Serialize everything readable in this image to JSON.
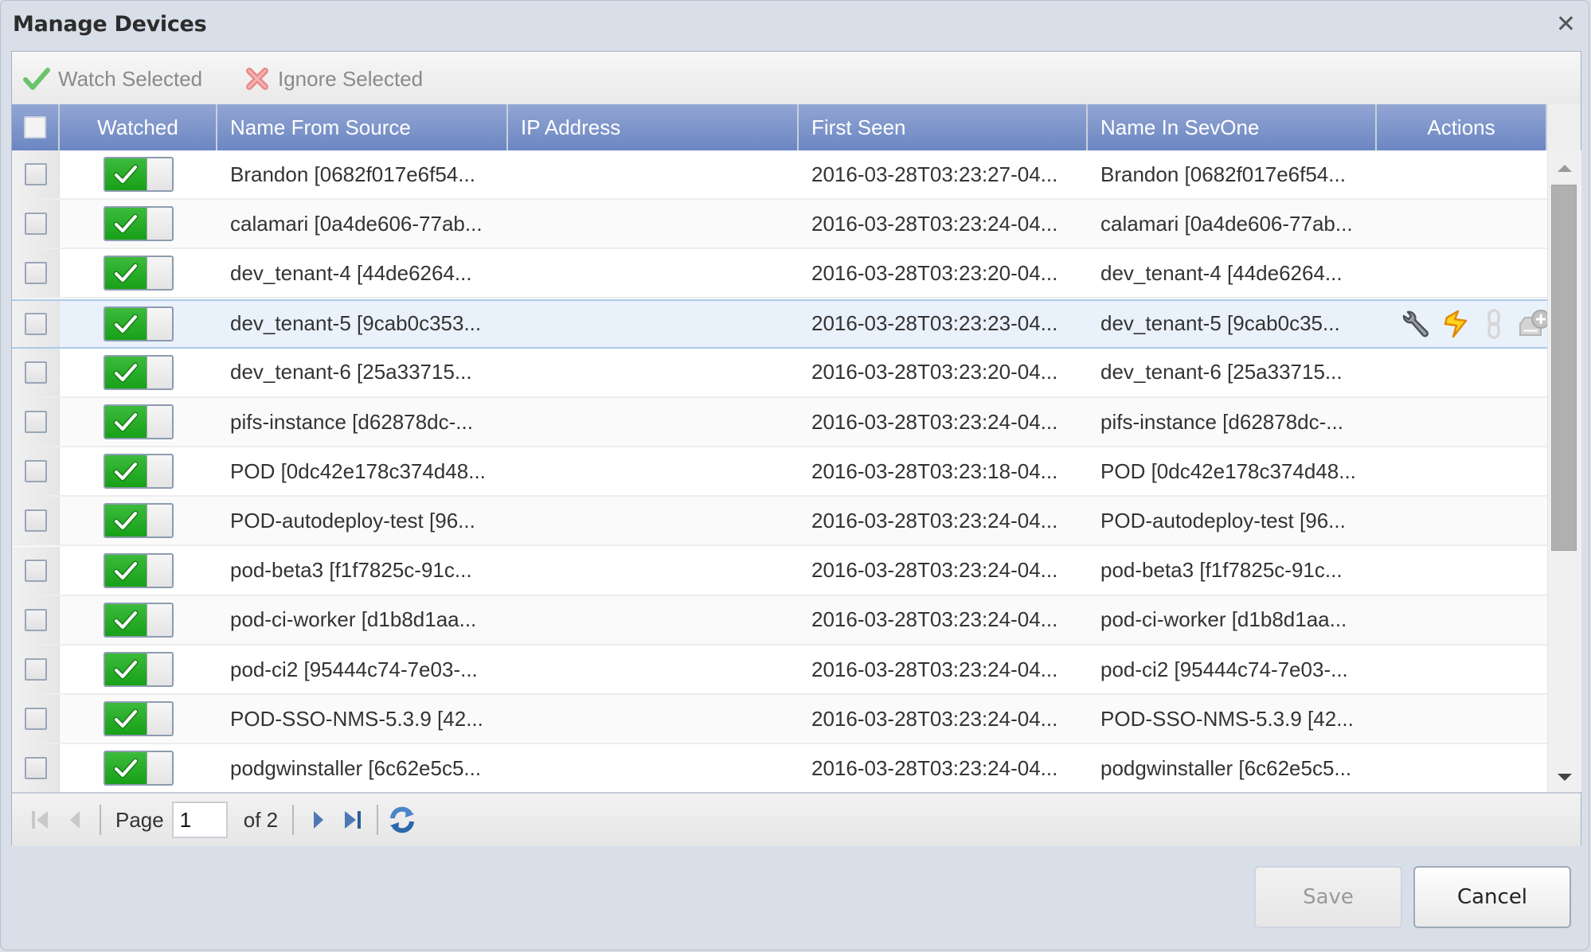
{
  "dialog": {
    "title": "Manage Devices",
    "close_icon": "close-icon"
  },
  "toolbar": {
    "watch_selected": {
      "label": "Watch Selected",
      "icon": "green-check-icon",
      "enabled": false
    },
    "ignore_selected": {
      "label": "Ignore Selected",
      "icon": "red-x-icon",
      "enabled": false
    }
  },
  "grid": {
    "columns": {
      "select_all": "",
      "watched": "Watched",
      "name_from_source": "Name From Source",
      "ip_address": "IP Address",
      "first_seen": "First Seen",
      "name_in_sevone": "Name In SevOne",
      "actions": "Actions"
    },
    "rows": [
      {
        "watched": true,
        "name_from_source": "Brandon [0682f017e6f54...",
        "ip_address": "",
        "first_seen": "2016-03-28T03:23:27-04...",
        "name_in_sevone": "Brandon [0682f017e6f54..."
      },
      {
        "watched": true,
        "name_from_source": "calamari [0a4de606-77ab...",
        "ip_address": "",
        "first_seen": "2016-03-28T03:23:24-04...",
        "name_in_sevone": "calamari [0a4de606-77ab..."
      },
      {
        "watched": true,
        "name_from_source": "dev_tenant-4 [44de6264...",
        "ip_address": "",
        "first_seen": "2016-03-28T03:23:20-04...",
        "name_in_sevone": "dev_tenant-4 [44de6264..."
      },
      {
        "watched": true,
        "name_from_source": "dev_tenant-5 [9cab0c353...",
        "ip_address": "",
        "first_seen": "2016-03-28T03:23:23-04...",
        "name_in_sevone": "dev_tenant-5 [9cab0c35...",
        "hovered": true,
        "actions": [
          "wrench-icon",
          "lightning-icon",
          "chain-link-icon",
          "add-device-icon"
        ]
      },
      {
        "watched": true,
        "name_from_source": "dev_tenant-6 [25a33715...",
        "ip_address": "",
        "first_seen": "2016-03-28T03:23:20-04...",
        "name_in_sevone": "dev_tenant-6 [25a33715..."
      },
      {
        "watched": true,
        "name_from_source": "pifs-instance [d62878dc-...",
        "ip_address": "",
        "first_seen": "2016-03-28T03:23:24-04...",
        "name_in_sevone": "pifs-instance [d62878dc-..."
      },
      {
        "watched": true,
        "name_from_source": "POD [0dc42e178c374d48...",
        "ip_address": "",
        "first_seen": "2016-03-28T03:23:18-04...",
        "name_in_sevone": "POD [0dc42e178c374d48..."
      },
      {
        "watched": true,
        "name_from_source": "POD-autodeploy-test [96...",
        "ip_address": "",
        "first_seen": "2016-03-28T03:23:24-04...",
        "name_in_sevone": "POD-autodeploy-test [96..."
      },
      {
        "watched": true,
        "name_from_source": "pod-beta3 [f1f7825c-91c...",
        "ip_address": "",
        "first_seen": "2016-03-28T03:23:24-04...",
        "name_in_sevone": "pod-beta3 [f1f7825c-91c..."
      },
      {
        "watched": true,
        "name_from_source": "pod-ci-worker [d1b8d1aa...",
        "ip_address": "",
        "first_seen": "2016-03-28T03:23:24-04...",
        "name_in_sevone": "pod-ci-worker [d1b8d1aa..."
      },
      {
        "watched": true,
        "name_from_source": "pod-ci2 [95444c74-7e03-...",
        "ip_address": "",
        "first_seen": "2016-03-28T03:23:24-04...",
        "name_in_sevone": "pod-ci2 [95444c74-7e03-..."
      },
      {
        "watched": true,
        "name_from_source": "POD-SSO-NMS-5.3.9 [42...",
        "ip_address": "",
        "first_seen": "2016-03-28T03:23:24-04...",
        "name_in_sevone": "POD-SSO-NMS-5.3.9 [42..."
      },
      {
        "watched": true,
        "name_from_source": "podgwinstaller [6c62e5c5...",
        "ip_address": "",
        "first_seen": "2016-03-28T03:23:24-04...",
        "name_in_sevone": "podgwinstaller [6c62e5c5..."
      }
    ]
  },
  "pager": {
    "page_label": "Page",
    "current_page": "1",
    "of_label": "of 2",
    "total_pages": 2
  },
  "buttons": {
    "save": {
      "label": "Save",
      "enabled": false
    },
    "cancel": {
      "label": "Cancel",
      "enabled": true
    }
  },
  "colors": {
    "header_top": "#93a6d3",
    "header_bottom": "#6b86c2",
    "toggle_on": "#18a018",
    "hover_row": "#e9f1fb"
  }
}
